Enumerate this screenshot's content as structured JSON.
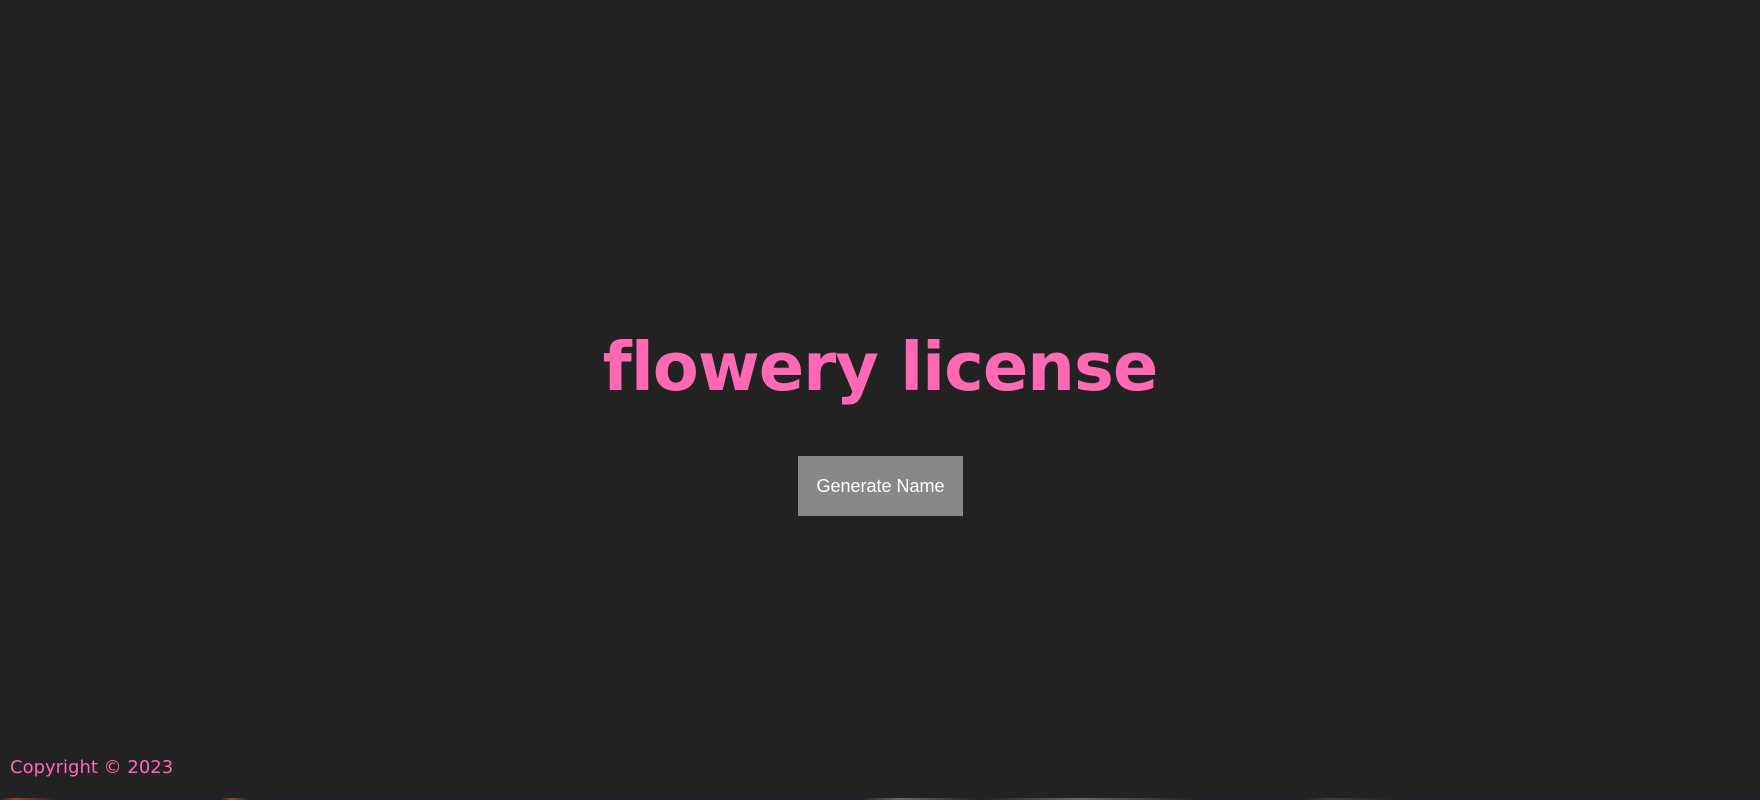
{
  "page": {
    "title": "flowery license",
    "button_label": "Generate Name",
    "footer_text": "Copyright © 2023"
  },
  "colors": {
    "background": "#222222",
    "accent": "#ff69b4",
    "button_background": "#888888",
    "button_text": "#ffffff"
  }
}
